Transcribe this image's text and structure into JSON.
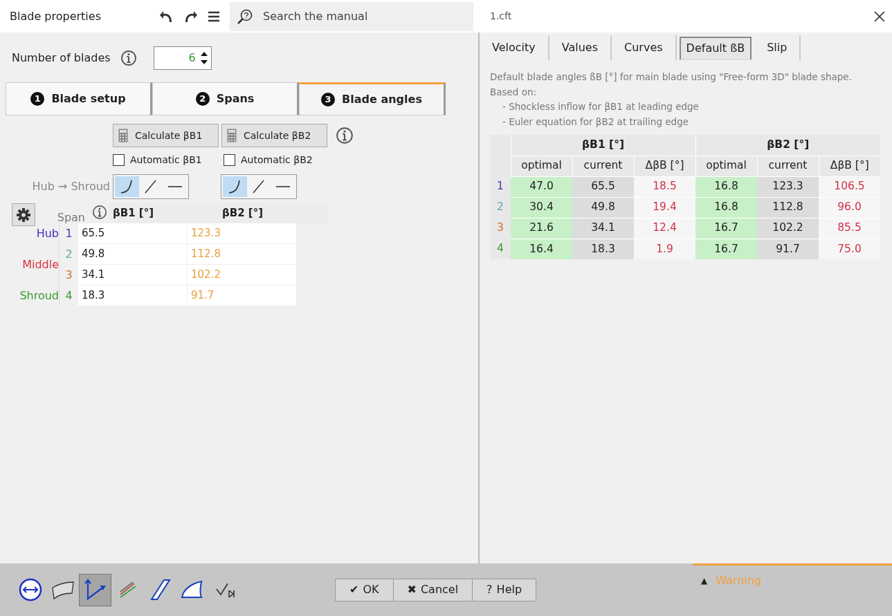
{
  "window": {
    "title": "Blade properties",
    "file": "1.cft"
  },
  "search": {
    "placeholder": "Search the manual"
  },
  "number_of_blades": {
    "label": "Number of blades",
    "value": "6"
  },
  "steps": [
    {
      "number": "1",
      "label": "Blade setup",
      "selected": false
    },
    {
      "number": "2",
      "label": "Spans",
      "selected": false
    },
    {
      "number": "3",
      "label": "Blade angles",
      "selected": true
    }
  ],
  "calculate_buttons": [
    "Calculate βB1",
    "Calculate βB2"
  ],
  "automatic": [
    {
      "label": "Automatic βB1",
      "checked": false
    },
    {
      "label": "Automatic βB2",
      "checked": false
    }
  ],
  "distribution": {
    "label": "Hub → Shroud",
    "groups": [
      [
        {
          "kind": "curve",
          "selected": true
        },
        {
          "kind": "slope",
          "selected": false
        },
        {
          "kind": "flat",
          "selected": false
        }
      ],
      [
        {
          "kind": "curve",
          "selected": true
        },
        {
          "kind": "slope",
          "selected": false
        },
        {
          "kind": "flat",
          "selected": false
        }
      ]
    ]
  },
  "span_table": {
    "heading": "Span",
    "columns": [
      "βB1 [°]",
      "βB2 [°]"
    ],
    "labels": [
      {
        "text": "Hub",
        "kind": "single",
        "color": "#3c2fc0"
      },
      {
        "text": "Middle",
        "kind": "double",
        "color": "#e03040"
      },
      {
        "text": "Shroud",
        "kind": "single",
        "color": "#3a9a30"
      }
    ],
    "rows": [
      {
        "index": "1",
        "color": "#4040b0",
        "values": [
          "65.5",
          "123.3"
        ]
      },
      {
        "index": "2",
        "color": "#60a8a0",
        "values": [
          "49.8",
          "112.8"
        ]
      },
      {
        "index": "3",
        "color": "#d07030",
        "values": [
          "34.1",
          "102.2"
        ]
      },
      {
        "index": "4",
        "color": "#3a9a30",
        "values": [
          "18.3",
          "91.7"
        ]
      }
    ]
  },
  "result_tabs": [
    {
      "label": "Velocity",
      "selected": false
    },
    {
      "label": "Values",
      "selected": false
    },
    {
      "label": "Curves",
      "selected": false
    },
    {
      "label": "Default ßB",
      "selected": true
    },
    {
      "label": "Slip",
      "selected": false
    }
  ],
  "description": {
    "lines": [
      "Default blade angles ßB [°] for main blade using \"Free-form 3D\" blade shape.",
      "Based on:"
    ],
    "bullets": [
      "- Shockless inflow for βB1 at leading edge",
      "- Euler equation for βB2 at trailing edge"
    ]
  },
  "default_table": {
    "groups": [
      "βB1 [°]",
      "βB2 [°]"
    ],
    "columns": [
      "optimal",
      "current",
      "ΔβB [°]",
      "optimal",
      "current",
      "ΔβB [°]"
    ],
    "rows": [
      {
        "index": "1",
        "color": "#4040b0",
        "values": [
          "47.0",
          "65.5",
          "18.5",
          "16.8",
          "123.3",
          "106.5"
        ]
      },
      {
        "index": "2",
        "color": "#60a8a0",
        "values": [
          "30.4",
          "49.8",
          "19.4",
          "16.8",
          "112.8",
          "96.0"
        ]
      },
      {
        "index": "3",
        "color": "#d07030",
        "values": [
          "21.6",
          "34.1",
          "12.4",
          "16.7",
          "102.2",
          "85.5"
        ]
      },
      {
        "index": "4",
        "color": "#3a9a30",
        "values": [
          "16.4",
          "18.3",
          "1.9",
          "16.7",
          "91.7",
          "75.0"
        ]
      }
    ]
  },
  "tools": [
    {
      "kind": "meridian",
      "selected": false
    },
    {
      "kind": "blade",
      "selected": false
    },
    {
      "kind": "angles",
      "selected": true
    },
    {
      "kind": "lines",
      "selected": false
    },
    {
      "kind": "thickness",
      "selected": false
    },
    {
      "kind": "edge",
      "selected": false
    },
    {
      "kind": "check",
      "selected": false
    }
  ],
  "buttons": [
    {
      "glyph": "✔",
      "label": "OK"
    },
    {
      "glyph": "✖",
      "label": "Cancel"
    },
    {
      "glyph": "?",
      "label": "Help"
    }
  ],
  "warning": {
    "glyph": "▲",
    "label": "Warning"
  }
}
